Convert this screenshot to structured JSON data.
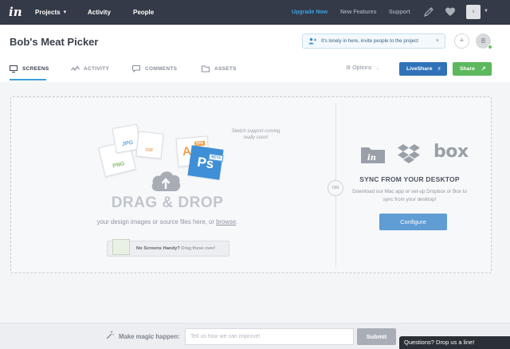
{
  "topnav": {
    "logo": "in",
    "links": [
      "Projects",
      "Activity",
      "People"
    ],
    "upgrade": "Upgrade Now",
    "new_features": "New Features",
    "support": "Support",
    "avatar_initial": "s"
  },
  "project": {
    "title": "Bob's Meat Picker",
    "invite_text": "It's lonely in here, invite people to the project",
    "invite_close": "×",
    "add_symbol": "+",
    "user_initial": "B"
  },
  "tabs": [
    {
      "label": "SCREENS",
      "active": true
    },
    {
      "label": "ACTIVITY",
      "active": false
    },
    {
      "label": "COMMENTS",
      "active": false
    },
    {
      "label": "ASSETS",
      "active": false
    }
  ],
  "toolbar": {
    "options_label": "Options",
    "liveshare_label": "LiveShare",
    "share_label": "Share"
  },
  "dropzone": {
    "file_cards": [
      "PNG",
      "JPG",
      "GIF",
      "Ai",
      "Ps"
    ],
    "eps_badge": "EPS",
    "beta_badge": "BETA",
    "sketch_note": "Sketch support coming really soon!",
    "title": "DRAG & DROP",
    "subtitle_before": "your design images or source files here, or ",
    "browse_link": "browse",
    "subtitle_after": ".",
    "no_screens_bold": "No Screens Handy?",
    "no_screens_text": " Drag these over!",
    "or_label": "OR"
  },
  "sync": {
    "box_label": "box",
    "title": "SYNC FROM YOUR DESKTOP",
    "description": "Download our Mac app or set-up Dropbox or Box to sync from your desktop!",
    "configure_label": "Configure"
  },
  "footer": {
    "magic_label": "Make magic happen:",
    "input_placeholder": "Tell us how we can improve!",
    "submit_label": "Submit",
    "chat_label": "Questions? Drop us a line!"
  },
  "colors": {
    "nav_bg": "#343a47",
    "accent_blue": "#3ba1e0",
    "liveshare_blue": "#2f72b8",
    "share_green": "#5cb85c",
    "configure_blue": "#5f9dd4"
  },
  "icons": [
    "invision-logo-icon",
    "chevron-down-icon",
    "pen-icon",
    "heart-icon",
    "invite-people-icon",
    "close-icon",
    "screens-icon",
    "activity-icon",
    "comments-icon",
    "folder-icon",
    "gear-icon",
    "lightning-icon",
    "share-arrow-icon",
    "cloud-upload-icon",
    "invision-folder-icon",
    "dropbox-icon",
    "box-logo-icon",
    "magic-wand-icon"
  ]
}
